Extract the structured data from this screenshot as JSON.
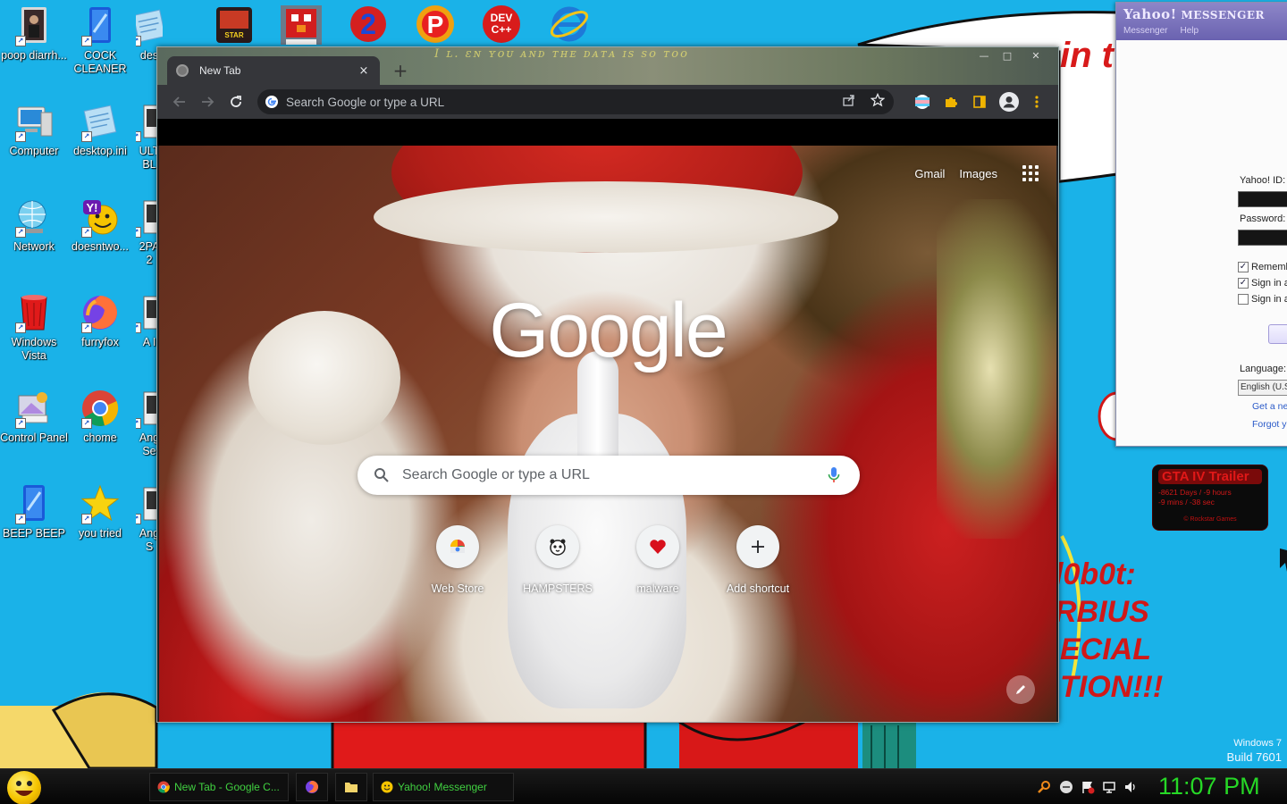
{
  "desktop": {
    "icons": [
      {
        "label": "poop diarrh...",
        "icon": "book-figure-icon"
      },
      {
        "label": "COCK CLEANER",
        "icon": "cleaner-icon"
      },
      {
        "label": "des",
        "icon": "text-file-icon"
      },
      {
        "label": "Computer",
        "icon": "computer-icon"
      },
      {
        "label": "desktop.ini",
        "icon": "text-file-icon"
      },
      {
        "label": "ULT BL",
        "icon": "app-icon"
      },
      {
        "label": "Network",
        "icon": "network-globe-icon"
      },
      {
        "label": "doesntwo...",
        "icon": "yahoo-smiley-icon"
      },
      {
        "label": "2PA 2",
        "icon": "app-icon"
      },
      {
        "label": "Windows Vista",
        "icon": "recycle-bin-icon"
      },
      {
        "label": "furryfox",
        "icon": "firefox-icon"
      },
      {
        "label": "A I",
        "icon": "app-icon"
      },
      {
        "label": "Control Panel",
        "icon": "control-panel-icon"
      },
      {
        "label": "chome",
        "icon": "chrome-icon"
      },
      {
        "label": "Ang Se",
        "icon": "app-icon"
      },
      {
        "label": "BEEP BEEP",
        "icon": "cleaner-icon"
      },
      {
        "label": "you tried",
        "icon": "star-icon"
      },
      {
        "label": "Ang S",
        "icon": "app-icon"
      }
    ],
    "top_icons": [
      {
        "name": "star-wars-icon"
      },
      {
        "name": "elmo-icon"
      },
      {
        "name": "number-2-icon"
      },
      {
        "name": "letter-p-icon"
      },
      {
        "name": "dev-cpp-icon"
      },
      {
        "name": "internet-explorer-icon"
      }
    ],
    "top_dev_label": "DEV C++",
    "scrawls": {
      "top": "in t",
      "right_1": "l0b0t:",
      "right_2": "RBIUS",
      "right_3": "ECIAL",
      "right_4": "TION!!!"
    },
    "watermark": {
      "line1": "Windows 7",
      "line2": "Build 7601"
    }
  },
  "chrome": {
    "tab_title": "New Tab",
    "tab_close": "×",
    "new_tab": "+",
    "window_controls": {
      "minimize": "—",
      "maximize": "□",
      "close": "✕"
    },
    "frame_scribble": "I ʟ. ɛɴ ʏᴏᴜ ᴀɴᴅ ᴛʜᴇ ᴅᴀᴛᴀ ɪs sᴏ ᴛᴏᴏ",
    "omnibox_placeholder": "Search Google or type a URL",
    "ntp": {
      "links": {
        "gmail": "Gmail",
        "images": "Images"
      },
      "logo": "Google",
      "search_placeholder": "Search Google or type a URL",
      "shortcuts": [
        {
          "label": "Web Store",
          "icon": "web-store-icon"
        },
        {
          "label": "HAMPSTERS",
          "icon": "hamster-icon"
        },
        {
          "label": "malware",
          "icon": "heart-icon"
        },
        {
          "label": "Add shortcut",
          "icon": "plus-icon"
        }
      ]
    }
  },
  "yahoo": {
    "brand_a": "Yahoo!",
    "brand_b": "MESSENGER",
    "menu": [
      "Messenger",
      "Help"
    ],
    "id_label": "Yahoo! ID:",
    "password_label": "Password:",
    "remember": "Rememb",
    "signin_a": "Sign in a",
    "signin_b": "Sign in as",
    "language_label": "Language:",
    "language_value": "English (U.S",
    "get_new": "Get a ne",
    "forgot": "Forgot y"
  },
  "gta": {
    "title": "GTA IV Trailer",
    "countdown": "-8621 Days / -9 hours",
    "countdown2": "-9 mins / -38 sec",
    "credit": "© Rockstar Games"
  },
  "taskbar": {
    "items": [
      {
        "label": "New Tab - Google C...",
        "icon": "chrome-icon"
      },
      {
        "label": "",
        "icon": "firefox-icon"
      },
      {
        "label": "",
        "icon": "folder-icon"
      },
      {
        "label": "Yahoo! Messenger",
        "icon": "yahoo-smiley-icon"
      }
    ],
    "clock": "11:07 PM"
  }
}
